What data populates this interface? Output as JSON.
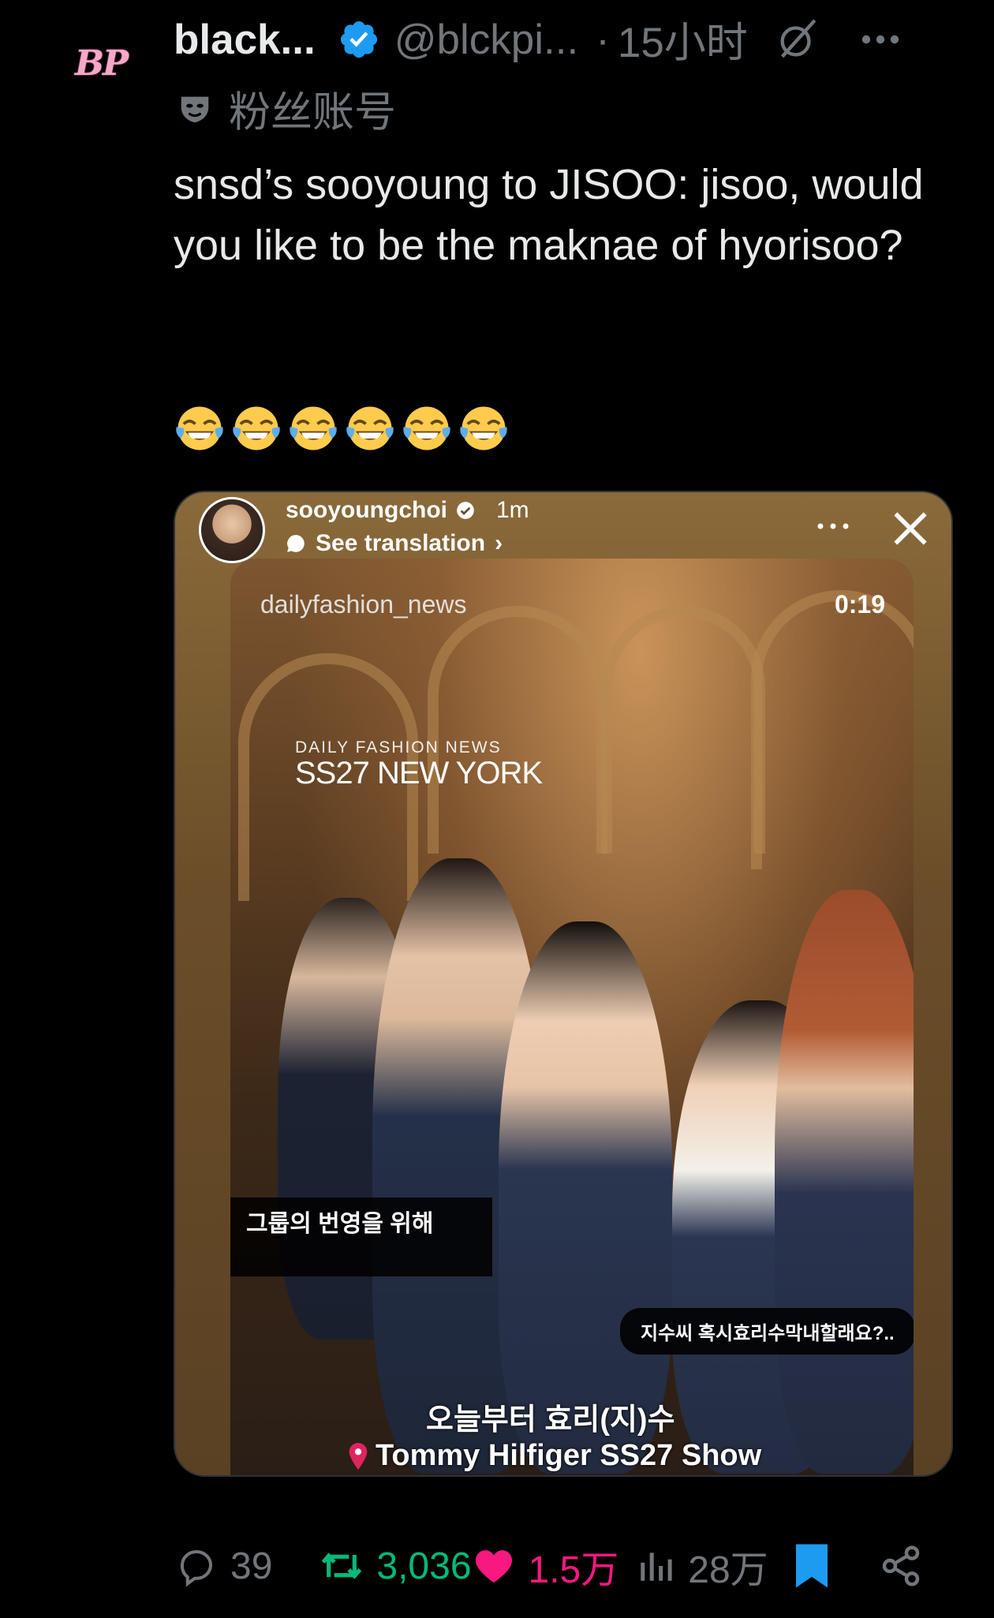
{
  "author": {
    "avatar_text": "BP",
    "display_name": "black...",
    "handle": "@blckpi...",
    "separator": "·",
    "time": "15小时",
    "label": "粉丝账号"
  },
  "tweet": {
    "text": "snsd’s sooyoung to JISOO: jisoo, would you like to be the maknae of hyorisoo?",
    "emoji_count": 6
  },
  "media": {
    "story_user": "sooyoungchoi",
    "story_time": "1m",
    "see_translation": "See translation",
    "video_source": "dailyfashion_news",
    "duration": "0:19",
    "watermark_small": "DAILY FASHION NEWS",
    "watermark_big": "SS27 NEW YORK",
    "subtitle_line1": "그룹의 번영을 위해",
    "subtitle_line2": "",
    "bubble_text": "지수씨 혹시효리수막내할래요?..",
    "caption_main": "오늘부터 효리(지)수",
    "caption_location": "Tommy Hilfiger SS27 Show"
  },
  "actions": {
    "replies": "39",
    "retweets": "3,036",
    "likes": "1.5万",
    "views": "28万"
  },
  "colors": {
    "background": "#000000",
    "text_primary": "#e7e9ea",
    "text_secondary": "#71767b",
    "verified": "#1d9bf0",
    "retweet_active": "#00ba7c",
    "like_active": "#f91880",
    "bookmark_active": "#1d9bf0"
  },
  "icons": [
    "verified-badge-icon",
    "grok-icon",
    "more-icon",
    "fan-mask-icon",
    "reply-icon",
    "retweet-icon",
    "like-icon",
    "views-icon",
    "bookmark-icon",
    "share-icon",
    "close-icon",
    "location-pin-icon"
  ]
}
